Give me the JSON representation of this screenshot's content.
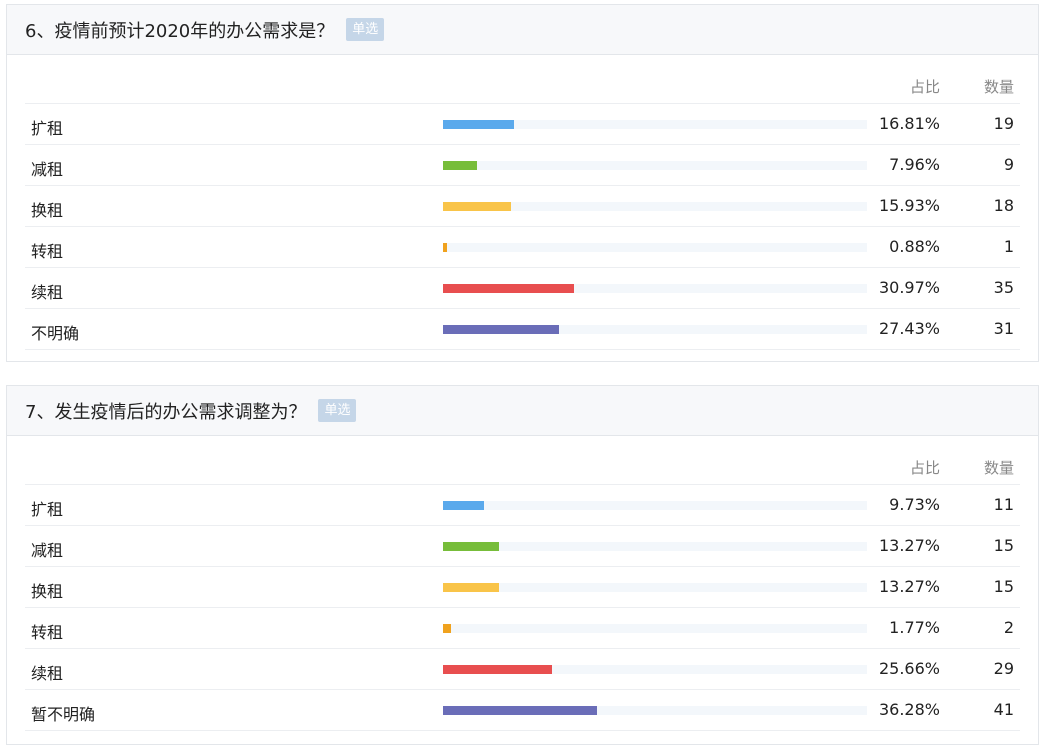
{
  "colors": [
    "#5aa9ec",
    "#77bd3a",
    "#f9c449",
    "#f0a21e",
    "#e84e4f",
    "#6a6db8"
  ],
  "questions": [
    {
      "title": "6、疫情前预计2020年的办公需求是？",
      "badge": "单选",
      "col_pct": "占比",
      "col_cnt": "数量",
      "rows": [
        {
          "label": "扩租",
          "pct": "16.81%",
          "count": "19",
          "share": 0.1681
        },
        {
          "label": "减租",
          "pct": "7.96%",
          "count": "9",
          "share": 0.0796
        },
        {
          "label": "换租",
          "pct": "15.93%",
          "count": "18",
          "share": 0.1593
        },
        {
          "label": "转租",
          "pct": "0.88%",
          "count": "1",
          "share": 0.0088
        },
        {
          "label": "续租",
          "pct": "30.97%",
          "count": "35",
          "share": 0.3097
        },
        {
          "label": "不明确",
          "pct": "27.43%",
          "count": "31",
          "share": 0.2743
        }
      ]
    },
    {
      "title": "7、发生疫情后的办公需求调整为？",
      "badge": "单选",
      "col_pct": "占比",
      "col_cnt": "数量",
      "rows": [
        {
          "label": "扩租",
          "pct": "9.73%",
          "count": "11",
          "share": 0.0973
        },
        {
          "label": "减租",
          "pct": "13.27%",
          "count": "15",
          "share": 0.1327
        },
        {
          "label": "换租",
          "pct": "13.27%",
          "count": "15",
          "share": 0.1327
        },
        {
          "label": "转租",
          "pct": "1.77%",
          "count": "2",
          "share": 0.0177
        },
        {
          "label": "续租",
          "pct": "25.66%",
          "count": "29",
          "share": 0.2566
        },
        {
          "label": "暂不明确",
          "pct": "36.28%",
          "count": "41",
          "share": 0.3628
        }
      ]
    }
  ]
}
